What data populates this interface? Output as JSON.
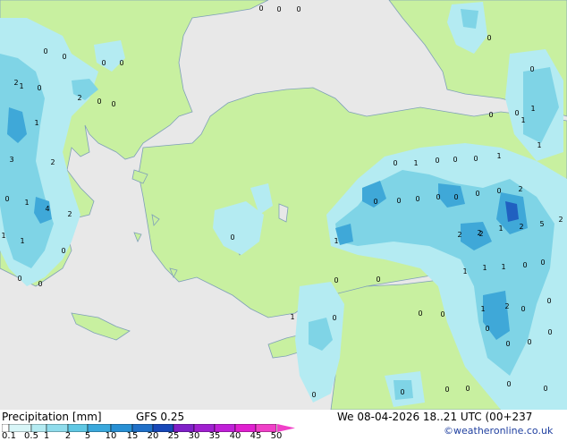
{
  "map": {
    "colors": {
      "sea": "#e8e8e8",
      "land": "#c8f0a0",
      "coast": "#7fa0b8",
      "precip_light": "#b4ebf2",
      "precip_med": "#7fd4e6",
      "precip_heavy": "#3fa8d8",
      "precip_very_heavy": "#2060c0"
    },
    "point_labels": [
      "0",
      "0",
      "0",
      "0",
      "0",
      "0",
      "0",
      "0",
      "0",
      "2",
      "0",
      "1",
      "0",
      "2",
      "0",
      "0",
      "0",
      "1",
      "1",
      "1",
      "3",
      "2",
      "1",
      "0",
      "1",
      "0",
      "0",
      "0",
      "1",
      "0",
      "0",
      "0",
      "2",
      "0",
      "0",
      "0",
      "0",
      "0",
      "1",
      "4",
      "2",
      "2",
      "2",
      "1",
      "2",
      "5",
      "2",
      "2",
      "1",
      "0",
      "1",
      "1",
      "0",
      "1",
      "1",
      "1",
      "0",
      "0",
      "0",
      "0",
      "0",
      "0",
      "1",
      "2",
      "0",
      "0",
      "0",
      "0",
      "0",
      "1",
      "0",
      "0",
      "0",
      "0",
      "0",
      "0",
      "0",
      "0",
      "0",
      "0"
    ]
  },
  "footer": {
    "title": "Precipitation [mm]",
    "model": "GFS 0.25",
    "datetime": "We 08-04-2026 18..21 UTC (00+237",
    "credit": "©weatheronline.co.uk",
    "legend_values": [
      "0.1",
      "0.5",
      "1",
      "2",
      "5",
      "10",
      "15",
      "20",
      "25",
      "30",
      "35",
      "40",
      "45",
      "50"
    ],
    "legend_colors": [
      "#ffffff",
      "#d8f6f8",
      "#b4ebf2",
      "#8fdcec",
      "#60c8e4",
      "#3aa8dc",
      "#2890d4",
      "#2070c8",
      "#1848b8",
      "#8020c8",
      "#a020d0",
      "#c020d8",
      "#e020d0",
      "#f040c8"
    ]
  }
}
